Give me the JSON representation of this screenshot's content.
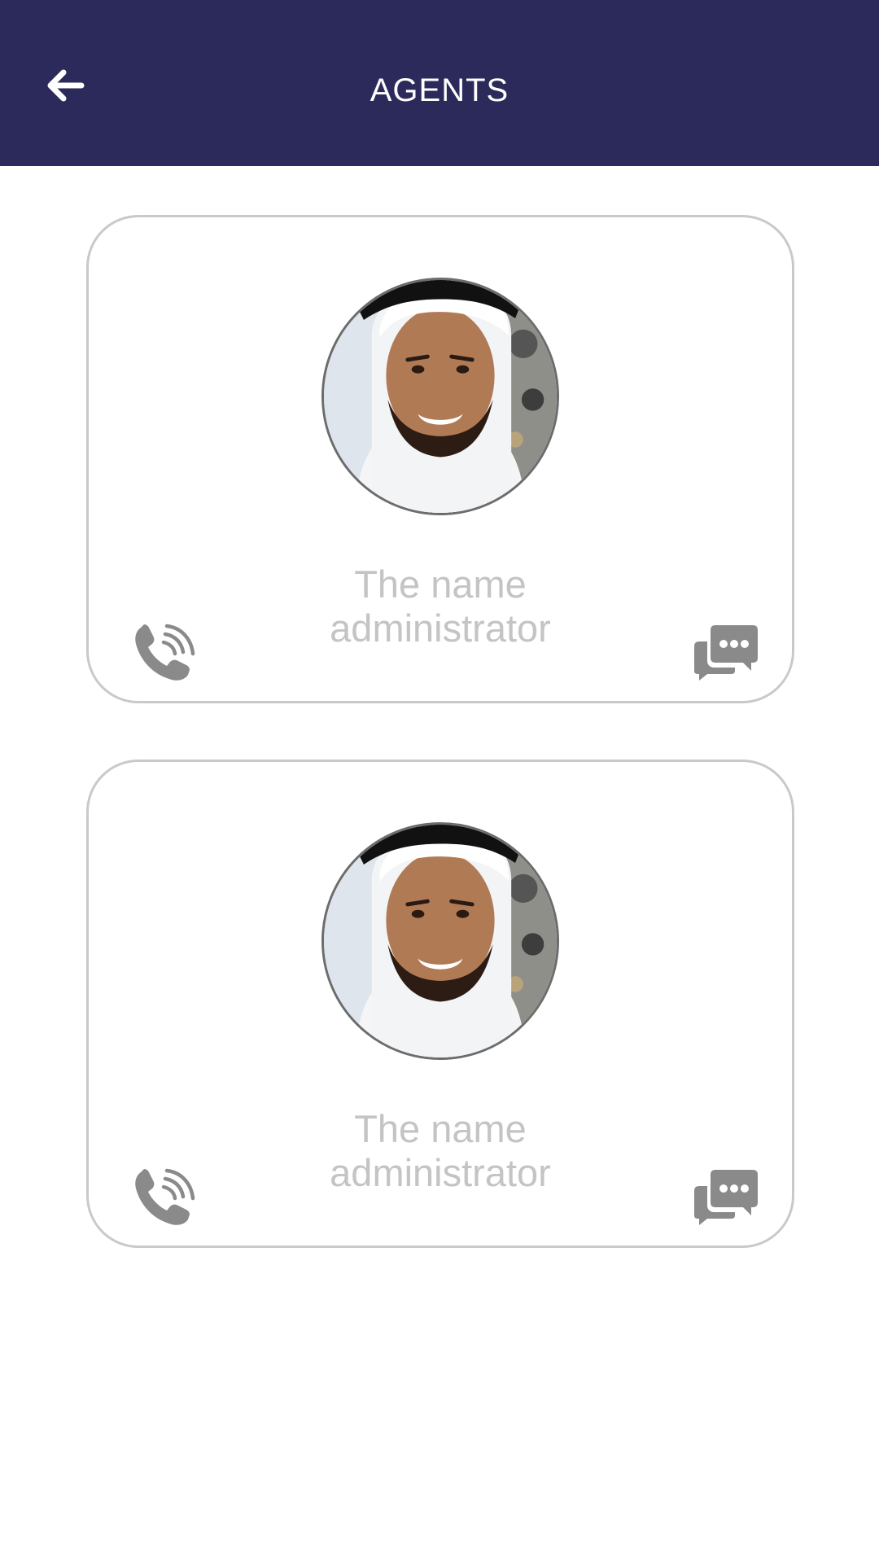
{
  "header": {
    "title": "AGENTS",
    "back_icon": "arrow-left-icon",
    "background_color": "#2b2a5a"
  },
  "agents": [
    {
      "name_line1": "The name",
      "name_line2": "administrator",
      "avatar": "agent-photo",
      "call_icon": "phone-icon",
      "chat_icon": "chat-bubbles-icon"
    },
    {
      "name_line1": "The name",
      "name_line2": "administrator",
      "avatar": "agent-photo",
      "call_icon": "phone-icon",
      "chat_icon": "chat-bubbles-icon"
    }
  ],
  "colors": {
    "card_border": "#c9c9c9",
    "name_text": "#c4c4c4",
    "icon_gray": "#8a8a8a"
  }
}
